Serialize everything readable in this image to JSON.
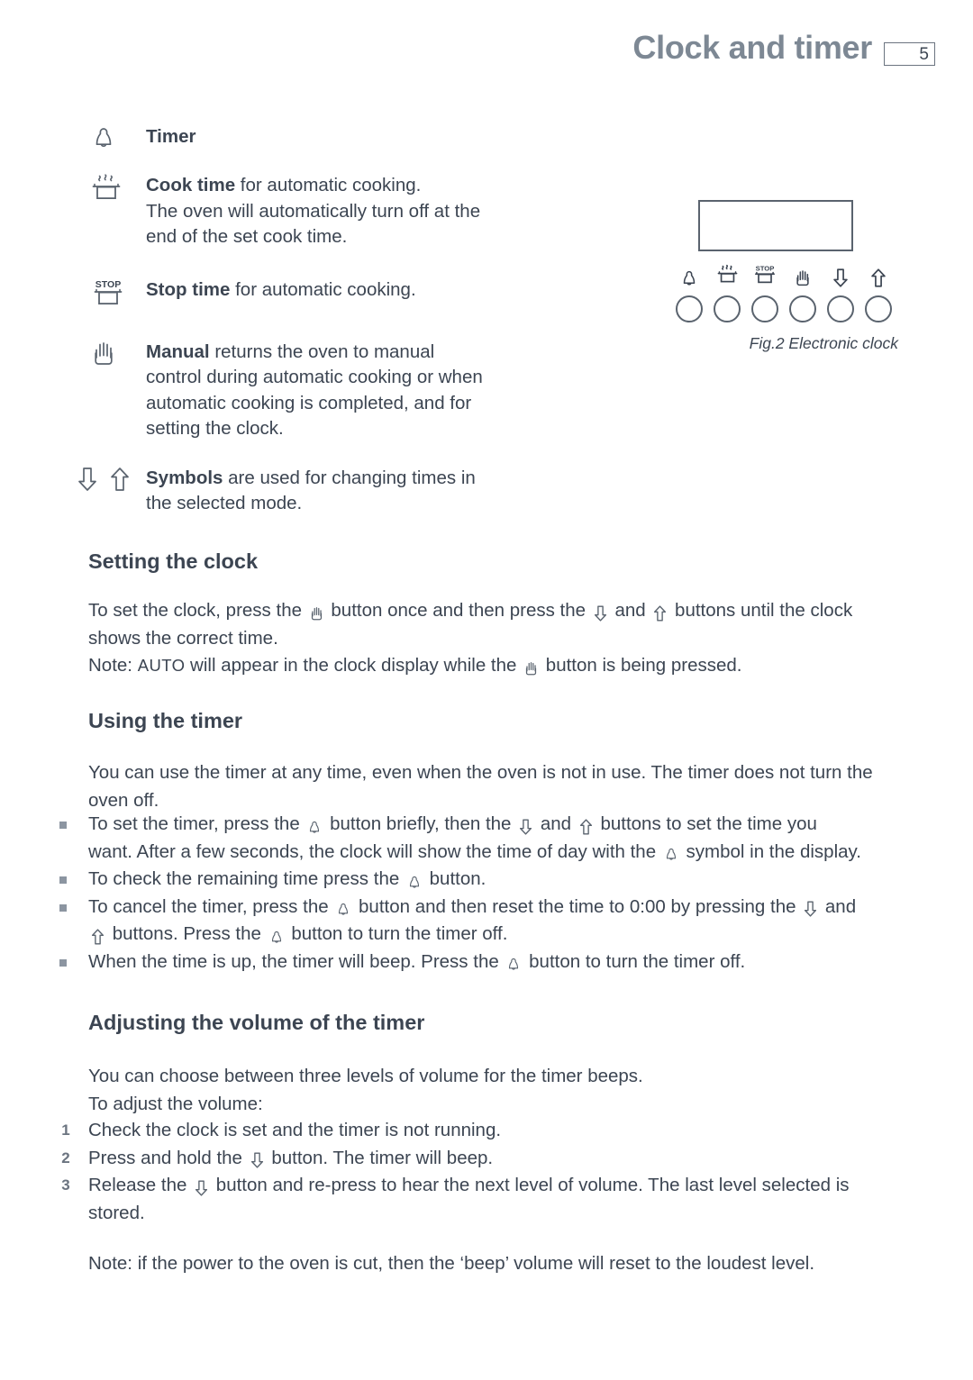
{
  "header": {
    "title": "Clock and timer",
    "page_number": "5"
  },
  "legend": {
    "rows": [
      {
        "icon": "bell-icon",
        "bold": "Timer",
        "rest": ""
      },
      {
        "icon": "pot-steam-icon",
        "bold": "Cook time",
        "rest": " for automatic cooking.",
        "lines": [
          "The oven will automatically turn off at the",
          "end of the set cook time."
        ]
      },
      {
        "icon": "pot-stop-icon",
        "bold": "Stop time",
        "rest": " for automatic cooking.",
        "lines": []
      },
      {
        "icon": "hand-icon",
        "bold": "Manual",
        "rest": " returns the oven to manual",
        "lines": [
          "control during automatic cooking or when",
          "automatic cooking is completed, and for",
          "setting the clock."
        ]
      },
      {
        "icon": "arrow-down-icon arrow-up-icon",
        "bold": "Symbols",
        "rest": " are used for changing times in",
        "lines": [
          "the selected mode."
        ]
      }
    ]
  },
  "figure": {
    "caption": "Fig.2 Electronic clock",
    "display_value": "",
    "buttons": [
      {
        "icon": "bell-icon",
        "name": "timer-button"
      },
      {
        "icon": "pot-steam-icon",
        "name": "cook-time-button"
      },
      {
        "icon": "pot-stop-icon",
        "name": "stop-time-button"
      },
      {
        "icon": "hand-icon",
        "name": "manual-button"
      },
      {
        "icon": "arrow-down-icon",
        "name": "decrease-button"
      },
      {
        "icon": "arrow-up-icon",
        "name": "increase-button"
      }
    ],
    "stop_label": "STOP"
  },
  "sections": {
    "setting_clock": {
      "heading": "Setting the clock",
      "line1_a": "To set the clock, press the ",
      "line1_b": " button once and then press the ",
      "line1_c": " and ",
      "line1_d": " buttons until the clock",
      "line2": "shows the correct time.",
      "line3_a": "Note: ",
      "line3_auto": "AUTO",
      "line3_b": " will appear in the clock display while the ",
      "line3_c": " button is being pressed."
    },
    "using_timer": {
      "heading": "Using the timer",
      "intro_line1": "You can use the timer at any time, even when the oven is not in use. The timer does not turn the",
      "intro_line2": "oven off.",
      "bullets": [
        {
          "a": "To set the timer, press the ",
          "b": " button briefly, then the ",
          "c": " and ",
          "d": " buttons to set the time you",
          "e": "want. After a few seconds, the clock will show the time of day with the ",
          "f": " symbol in the display."
        },
        {
          "a": "To check the remaining time press the ",
          "b": " button."
        },
        {
          "a": "To cancel the timer, press the ",
          "b": " button and then reset the time to 0:00 by pressing the ",
          "c": " and",
          "d": " buttons. Press the ",
          "e": " button to turn the timer off."
        },
        {
          "a": "When the time is up, the timer will beep. Press the ",
          "b": " button to turn the timer off."
        }
      ]
    },
    "volume": {
      "heading": "Adjusting the volume of the timer",
      "intro_line1": "You can choose between three levels of volume for the timer beeps.",
      "intro_line2": "To adjust the volume:",
      "steps": [
        {
          "num": "1",
          "a": "Check the clock is set and the timer is not running.",
          "b": "",
          "c": ""
        },
        {
          "num": "2",
          "a": "Press and hold the ",
          "b": " button. The timer will beep.",
          "c": ""
        },
        {
          "num": "3",
          "a": "Release the ",
          "b": " button and re-press to hear the next level of volume. The last level selected is",
          "c": "stored."
        }
      ],
      "note": "Note:  if the power to the oven is cut, then the ‘beep’ volume will reset to the loudest level."
    }
  },
  "colors": {
    "heading_gray": "#7d8894",
    "text": "#3c4552",
    "icon_stroke": "#5a636e",
    "bullet": "#8c95a1"
  }
}
